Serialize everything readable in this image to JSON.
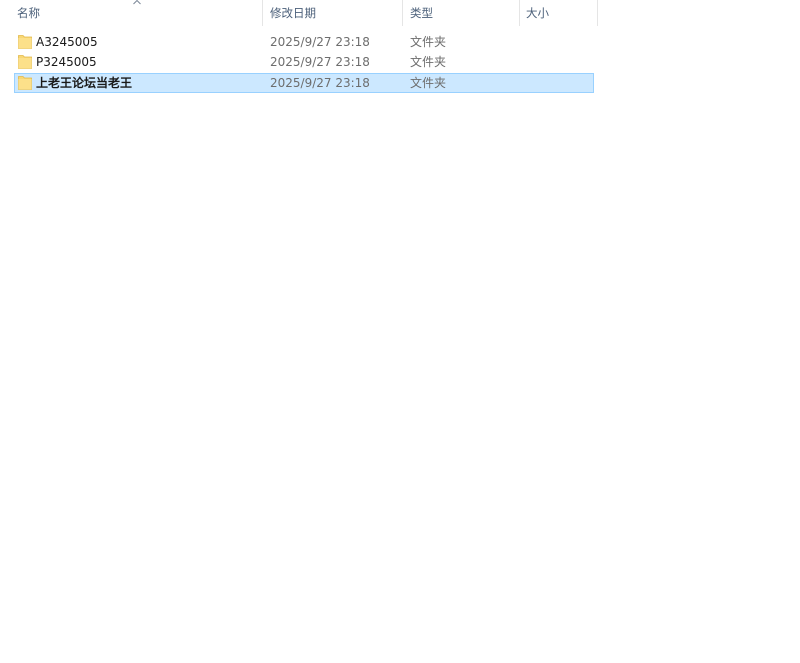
{
  "header": {
    "name": "名称",
    "date_modified": "修改日期",
    "type": "类型",
    "size": "大小",
    "sort_indicator": "^"
  },
  "rows": [
    {
      "name": "A3245005",
      "date": "2025/9/27 23:18",
      "type": "文件夹",
      "size": "",
      "icon": "folder-icon",
      "selected": false
    },
    {
      "name": "P3245005",
      "date": "2025/9/27 23:18",
      "type": "文件夹",
      "size": "",
      "icon": "folder-icon",
      "selected": false
    },
    {
      "name": "上老王论坛当老王",
      "date": "2025/9/27 23:18",
      "type": "文件夹",
      "size": "",
      "icon": "folder-icon",
      "selected": true
    }
  ],
  "colors": {
    "selection_bg": "#cce8ff",
    "selection_border": "#99d1ff",
    "header_text": "#4c607a",
    "secondary_text": "#6d6d6d",
    "folder_yellow": "#f8d775"
  }
}
